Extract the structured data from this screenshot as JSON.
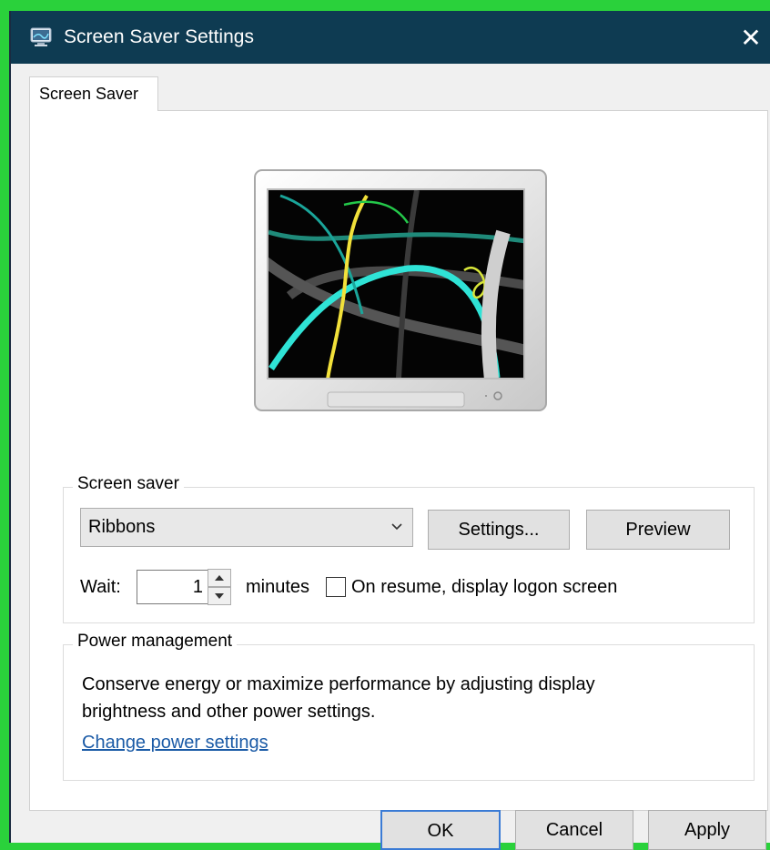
{
  "window": {
    "title": "Screen Saver Settings",
    "close_glyph": "✕",
    "title_icon": "display-settings-icon"
  },
  "tabs": [
    {
      "label": "Screen Saver",
      "selected": true
    }
  ],
  "preview": {
    "screen_saver_shown": "Ribbons"
  },
  "screen_saver": {
    "legend": "Screen saver",
    "selected": "Ribbons",
    "settings_label": "Settings...",
    "preview_label": "Preview",
    "wait_label": "Wait:",
    "wait_value": "1",
    "minutes_label": "minutes",
    "logon_label": "On resume, display logon screen",
    "logon_checked": false
  },
  "power": {
    "legend": "Power management",
    "description": "Conserve energy or maximize performance by adjusting display brightness and other power settings.",
    "link": "Change power settings"
  },
  "footer": {
    "ok": "OK",
    "cancel": "Cancel",
    "apply": "Apply"
  },
  "colors": {
    "titlebar": "#0e3b52",
    "frame": "#2ad13b",
    "link": "#1a5aa6",
    "ok_border": "#3a7bd5"
  }
}
